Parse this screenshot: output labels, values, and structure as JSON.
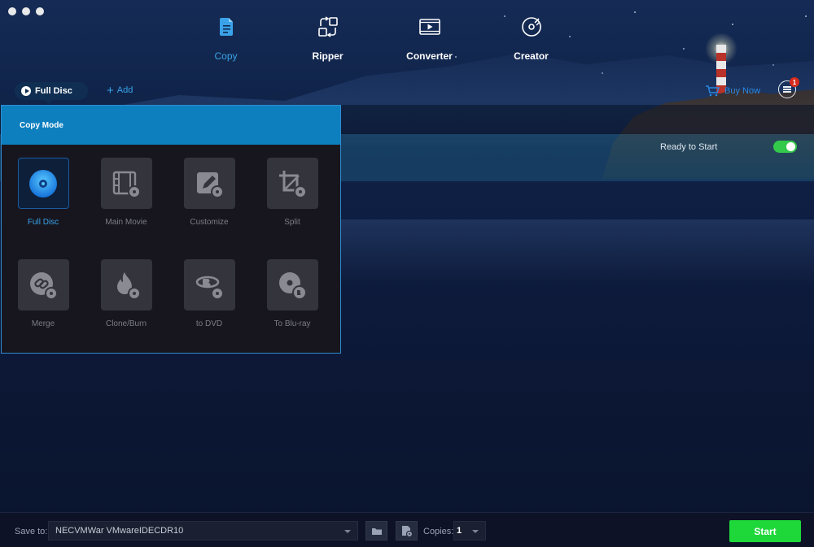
{
  "window": {
    "controls": [
      "close",
      "minimize",
      "zoom"
    ]
  },
  "nav": {
    "items": [
      {
        "label": "Copy",
        "icon": "copy-icon",
        "active": true
      },
      {
        "label": "Ripper",
        "icon": "ripper-icon",
        "active": false
      },
      {
        "label": "Converter",
        "icon": "converter-icon",
        "active": false
      },
      {
        "label": "Creator",
        "icon": "creator-icon",
        "active": false
      }
    ]
  },
  "toolbar": {
    "mode_label": "Full Disc",
    "add_label": "Add",
    "buy_label": "Buy Now",
    "notification_count": "1"
  },
  "disc": {
    "status": "Ready to Start",
    "toggle_on": true
  },
  "copy_mode": {
    "title": "Copy Mode",
    "modes": [
      {
        "label": "Full Disc",
        "icon": "disc-icon",
        "active": true
      },
      {
        "label": "Main Movie",
        "icon": "film-icon",
        "active": false
      },
      {
        "label": "Customize",
        "icon": "edit-icon",
        "active": false
      },
      {
        "label": "Split",
        "icon": "crop-icon",
        "active": false
      },
      {
        "label": "Merge",
        "icon": "link-icon",
        "active": false
      },
      {
        "label": "Clone/Burn",
        "icon": "flame-icon",
        "active": false
      },
      {
        "label": "to DVD",
        "icon": "bluray-to-dvd-icon",
        "active": false
      },
      {
        "label": "To Blu-ray",
        "icon": "disc-to-bluray-icon",
        "active": false
      }
    ]
  },
  "bottom": {
    "save_to_label": "Save to:",
    "save_to_value": "NECVMWar VMwareIDECDR10",
    "copies_label": "Copies:",
    "copies_value": "1",
    "start_label": "Start"
  },
  "colors": {
    "accent_blue": "#3aa2e8",
    "header_blue": "#0d7fbf",
    "start_green": "#1ed83a",
    "toggle_green": "#33c94a",
    "badge_red": "#d62a1d"
  }
}
